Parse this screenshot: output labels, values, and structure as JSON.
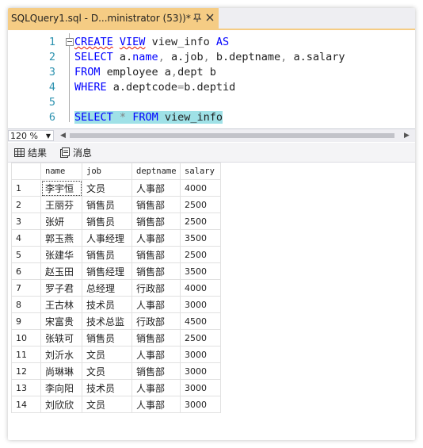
{
  "tab": {
    "title": "SQLQuery1.sql - D...ministrator (53))*"
  },
  "editor": {
    "lines": [
      {
        "num": "1",
        "segments": [
          [
            "kw sq",
            "CREATE"
          ],
          [
            "pl",
            " "
          ],
          [
            "kw sq",
            "VIEW"
          ],
          [
            "pl",
            " view_info "
          ],
          [
            "kw",
            "AS"
          ]
        ]
      },
      {
        "num": "2",
        "segments": [
          [
            "kw",
            "SELECT"
          ],
          [
            "pl",
            " a."
          ],
          [
            "kw",
            "name"
          ],
          [
            "gr",
            ","
          ],
          [
            "pl",
            " a."
          ],
          [
            "pl",
            "job"
          ],
          [
            "gr",
            ","
          ],
          [
            "pl",
            " b."
          ],
          [
            "pl",
            "deptname"
          ],
          [
            "gr",
            ","
          ],
          [
            "pl",
            " a."
          ],
          [
            "pl",
            "salary"
          ]
        ]
      },
      {
        "num": "3",
        "segments": [
          [
            "kw",
            "FROM"
          ],
          [
            "pl",
            " employee a"
          ],
          [
            "gr",
            ","
          ],
          [
            "pl",
            "dept b"
          ]
        ]
      },
      {
        "num": "4",
        "segments": [
          [
            "kw",
            "WHERE"
          ],
          [
            "pl",
            " a."
          ],
          [
            "pl",
            "deptcode"
          ],
          [
            "gr",
            "="
          ],
          [
            "pl",
            "b."
          ],
          [
            "pl",
            "deptid"
          ]
        ]
      },
      {
        "num": "5",
        "segments": []
      },
      {
        "num": "6",
        "segments": [
          [
            "kw sel-hl",
            "SELECT"
          ],
          [
            "pl sel-hl",
            " "
          ],
          [
            "gr sel-hl",
            "*"
          ],
          [
            "pl sel-hl",
            " "
          ],
          [
            "kw sel-hl",
            "FROM"
          ],
          [
            "pl sel-hl",
            " view_info"
          ]
        ]
      }
    ]
  },
  "zoom": {
    "value": "120 %"
  },
  "result_tabs": {
    "results_label": "结果",
    "messages_label": "消息"
  },
  "grid": {
    "columns": [
      "name",
      "job",
      "deptname",
      "salary"
    ],
    "rows": [
      [
        "1",
        "李宇恒",
        "文员",
        "人事部",
        "4000"
      ],
      [
        "2",
        "王丽芬",
        "销售员",
        "销售部",
        "2500"
      ],
      [
        "3",
        "张妍",
        "销售员",
        "销售部",
        "2500"
      ],
      [
        "4",
        "郭玉燕",
        "人事经理",
        "人事部",
        "3500"
      ],
      [
        "5",
        "张建华",
        "销售员",
        "销售部",
        "2500"
      ],
      [
        "6",
        "赵玉田",
        "销售经理",
        "销售部",
        "3500"
      ],
      [
        "7",
        "罗子君",
        "总经理",
        "行政部",
        "4000"
      ],
      [
        "8",
        "王古林",
        "技术员",
        "人事部",
        "3000"
      ],
      [
        "9",
        "宋富贵",
        "技术总监",
        "行政部",
        "4500"
      ],
      [
        "10",
        "张轶可",
        "销售员",
        "销售部",
        "2500"
      ],
      [
        "11",
        "刘沂水",
        "文员",
        "人事部",
        "3000"
      ],
      [
        "12",
        "尚琳琳",
        "文员",
        "销售部",
        "3000"
      ],
      [
        "13",
        "李向阳",
        "技术员",
        "人事部",
        "3000"
      ],
      [
        "14",
        "刘欣欣",
        "文员",
        "人事部",
        "3000"
      ]
    ]
  },
  "colors": {
    "tab_active": "#f5cc84",
    "keyword": "#0000ff",
    "line_number": "#2b91af",
    "selection": "#9fe1e7",
    "squiggle": "#e51400"
  }
}
